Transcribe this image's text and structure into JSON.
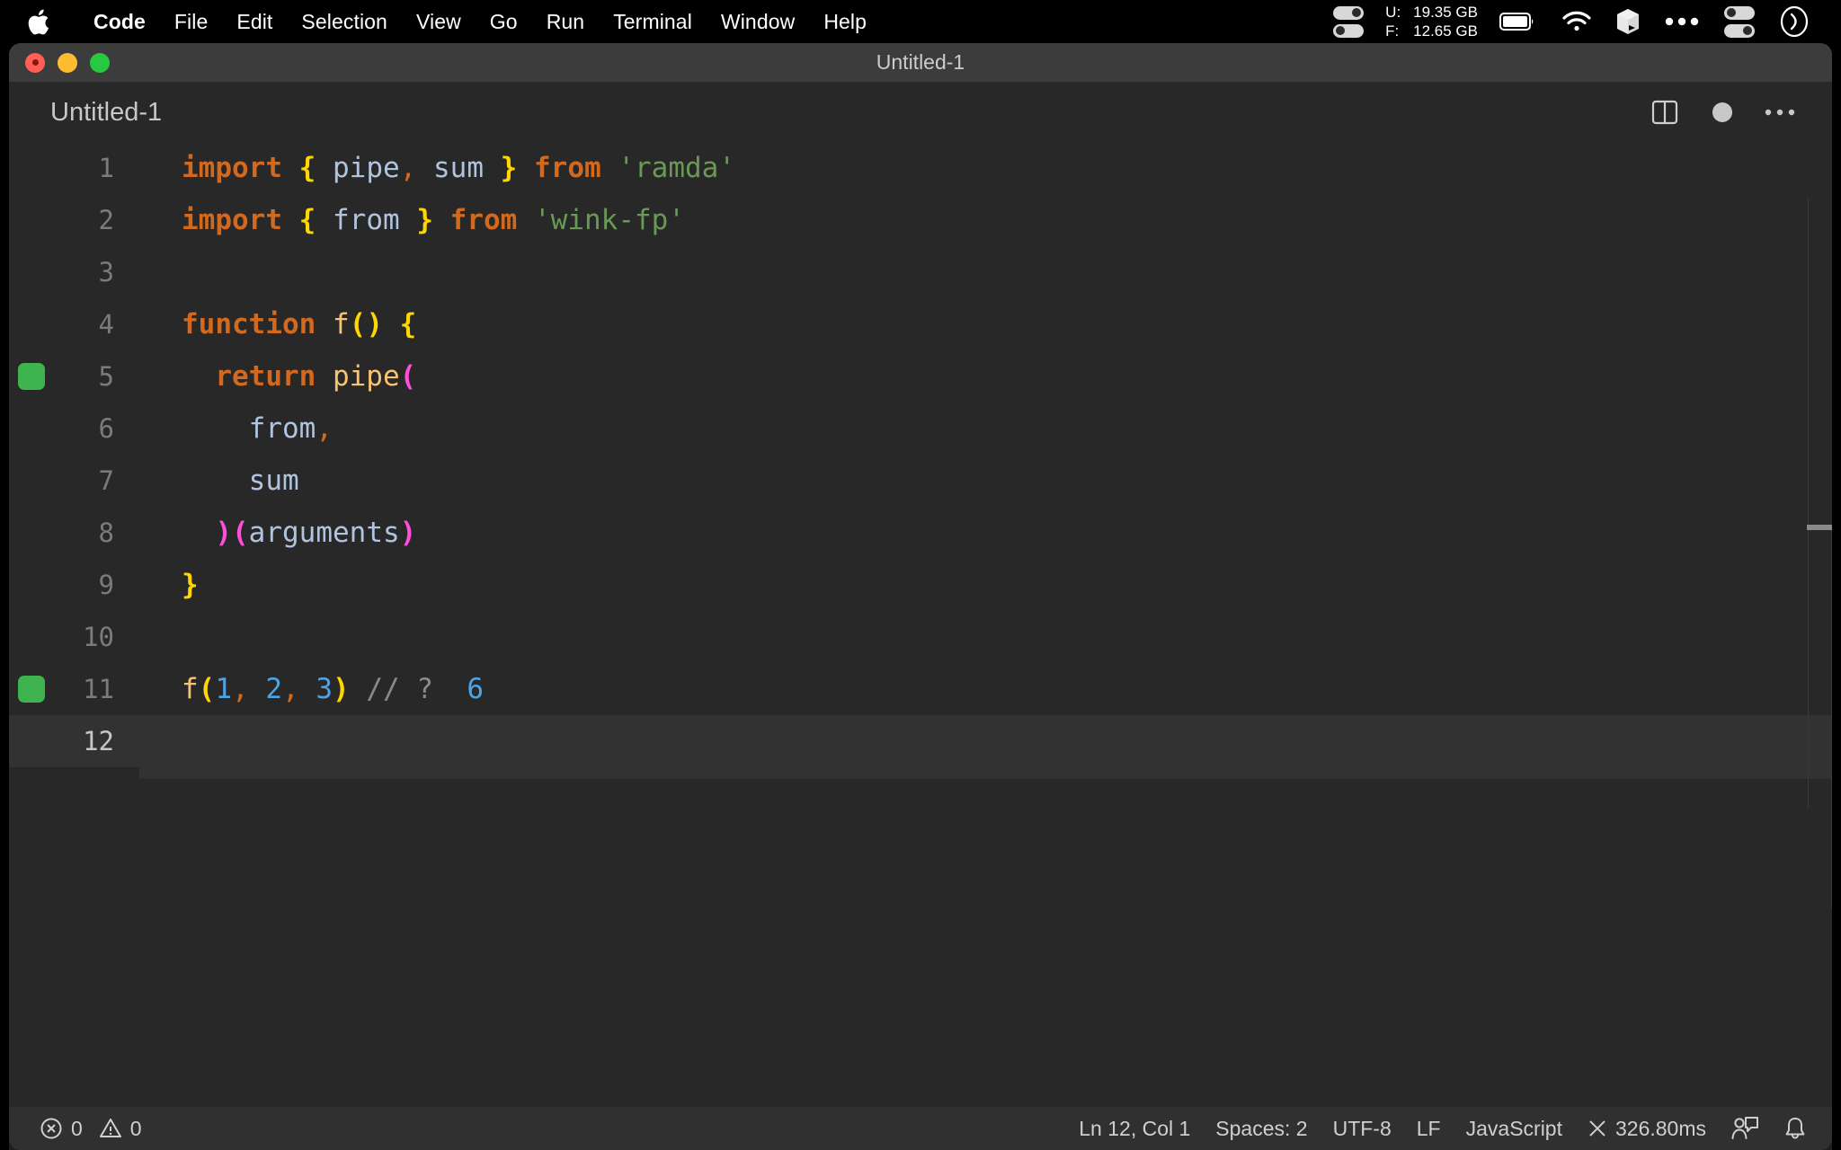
{
  "menubar": {
    "apple_icon": "apple-logo-icon",
    "items": [
      {
        "label": "Code",
        "bold": true
      },
      {
        "label": "File",
        "bold": false
      },
      {
        "label": "Edit",
        "bold": false
      },
      {
        "label": "Selection",
        "bold": false
      },
      {
        "label": "View",
        "bold": false
      },
      {
        "label": "Go",
        "bold": false
      },
      {
        "label": "Run",
        "bold": false
      },
      {
        "label": "Terminal",
        "bold": false
      },
      {
        "label": "Window",
        "bold": false
      },
      {
        "label": "Help",
        "bold": false
      }
    ],
    "status": {
      "memory": {
        "used_label": "U:",
        "used_value": "19.35 GB",
        "free_label": "F:",
        "free_value": "12.65 GB"
      },
      "icons": [
        "toggle-switches-icon",
        "battery-icon",
        "wifi-icon",
        "cube-app-icon",
        "ellipsis-icon",
        "control-center-icon",
        "siri-icon"
      ]
    }
  },
  "window": {
    "title": "Untitled-1",
    "traffic_lights": [
      "close",
      "minimize",
      "zoom"
    ]
  },
  "tabbar": {
    "title": "Untitled-1",
    "actions": [
      "split-editor-icon",
      "unsaved-dot-icon",
      "more-actions-icon"
    ]
  },
  "editor": {
    "language": "JavaScript",
    "lines": [
      {
        "n": "1",
        "marker": false,
        "current": false,
        "indent": 0,
        "tokens": [
          {
            "t": "import",
            "c": "t-key"
          },
          {
            "t": " ",
            "c": ""
          },
          {
            "t": "{",
            "c": "t-brace"
          },
          {
            "t": " ",
            "c": ""
          },
          {
            "t": "pipe",
            "c": "t-ident"
          },
          {
            "t": ",",
            "c": "t-comma"
          },
          {
            "t": " ",
            "c": ""
          },
          {
            "t": "sum",
            "c": "t-ident"
          },
          {
            "t": " ",
            "c": ""
          },
          {
            "t": "}",
            "c": "t-brace"
          },
          {
            "t": " ",
            "c": ""
          },
          {
            "t": "from",
            "c": "t-key"
          },
          {
            "t": " ",
            "c": ""
          },
          {
            "t": "'ramda'",
            "c": "t-str"
          }
        ]
      },
      {
        "n": "2",
        "marker": false,
        "current": false,
        "indent": 0,
        "tokens": [
          {
            "t": "import",
            "c": "t-key"
          },
          {
            "t": " ",
            "c": ""
          },
          {
            "t": "{",
            "c": "t-brace"
          },
          {
            "t": " ",
            "c": ""
          },
          {
            "t": "from",
            "c": "t-ident"
          },
          {
            "t": " ",
            "c": ""
          },
          {
            "t": "}",
            "c": "t-brace"
          },
          {
            "t": " ",
            "c": ""
          },
          {
            "t": "from",
            "c": "t-key"
          },
          {
            "t": " ",
            "c": ""
          },
          {
            "t": "'wink-fp'",
            "c": "t-str"
          }
        ]
      },
      {
        "n": "3",
        "marker": false,
        "current": false,
        "indent": 0,
        "tokens": []
      },
      {
        "n": "4",
        "marker": false,
        "current": false,
        "indent": 0,
        "tokens": [
          {
            "t": "function",
            "c": "t-key"
          },
          {
            "t": " ",
            "c": ""
          },
          {
            "t": "f",
            "c": "t-fn"
          },
          {
            "t": "()",
            "c": "t-paren-y"
          },
          {
            "t": " ",
            "c": ""
          },
          {
            "t": "{",
            "c": "t-brace"
          }
        ]
      },
      {
        "n": "5",
        "marker": true,
        "current": false,
        "indent": 1,
        "tokens": [
          {
            "t": "  ",
            "c": ""
          },
          {
            "t": "return",
            "c": "t-key"
          },
          {
            "t": " ",
            "c": ""
          },
          {
            "t": "pipe",
            "c": "t-fn"
          },
          {
            "t": "(",
            "c": "t-paren-m"
          }
        ]
      },
      {
        "n": "6",
        "marker": false,
        "current": false,
        "indent": 2,
        "tokens": [
          {
            "t": "    ",
            "c": ""
          },
          {
            "t": "from",
            "c": "t-ident"
          },
          {
            "t": ",",
            "c": "t-comma"
          }
        ]
      },
      {
        "n": "7",
        "marker": false,
        "current": false,
        "indent": 2,
        "tokens": [
          {
            "t": "    ",
            "c": ""
          },
          {
            "t": "sum",
            "c": "t-ident"
          }
        ]
      },
      {
        "n": "8",
        "marker": false,
        "current": false,
        "indent": 1,
        "tokens": [
          {
            "t": "  ",
            "c": ""
          },
          {
            "t": ")",
            "c": "t-paren-m"
          },
          {
            "t": "(",
            "c": "t-paren-m"
          },
          {
            "t": "arguments",
            "c": "t-ident"
          },
          {
            "t": ")",
            "c": "t-paren-m"
          }
        ]
      },
      {
        "n": "9",
        "marker": false,
        "current": false,
        "indent": 0,
        "tokens": [
          {
            "t": "}",
            "c": "t-brace"
          }
        ]
      },
      {
        "n": "10",
        "marker": false,
        "current": false,
        "indent": 0,
        "tokens": []
      },
      {
        "n": "11",
        "marker": true,
        "current": false,
        "indent": 0,
        "tokens": [
          {
            "t": "f",
            "c": "t-fn"
          },
          {
            "t": "(",
            "c": "t-paren-y"
          },
          {
            "t": "1",
            "c": "t-num"
          },
          {
            "t": ",",
            "c": "t-comma"
          },
          {
            "t": " ",
            "c": ""
          },
          {
            "t": "2",
            "c": "t-num"
          },
          {
            "t": ",",
            "c": "t-comma"
          },
          {
            "t": " ",
            "c": ""
          },
          {
            "t": "3",
            "c": "t-num"
          },
          {
            "t": ")",
            "c": "t-paren-y"
          },
          {
            "t": " ",
            "c": ""
          },
          {
            "t": "// ?",
            "c": "t-comment"
          },
          {
            "t": "  ",
            "c": ""
          },
          {
            "t": "6",
            "c": "t-result"
          }
        ]
      },
      {
        "n": "12",
        "marker": false,
        "current": true,
        "indent": 0,
        "tokens": []
      }
    ]
  },
  "statusbar": {
    "errors_icon": "error-circle-icon",
    "errors": "0",
    "warnings_icon": "warning-triangle-icon",
    "warnings": "0",
    "cursor_position": "Ln 12, Col 1",
    "indentation": "Spaces: 2",
    "encoding": "UTF-8",
    "eol": "LF",
    "language": "JavaScript",
    "runtime_icon": "close-x-icon",
    "runtime": "326.80ms",
    "feedback_icon": "feedback-person-icon",
    "notifications_icon": "bell-icon"
  },
  "colors": {
    "editor_bg": "#282828",
    "titlebar_bg": "#3c3c3c",
    "statusbar_bg": "#303030",
    "marker_green": "#3eb34f",
    "accent_orange": "#d2691e",
    "accent_yellow": "#ffd700",
    "accent_magenta": "#ff4fd8",
    "accent_blue": "#4fa3e3",
    "string_green": "#6a9955"
  }
}
